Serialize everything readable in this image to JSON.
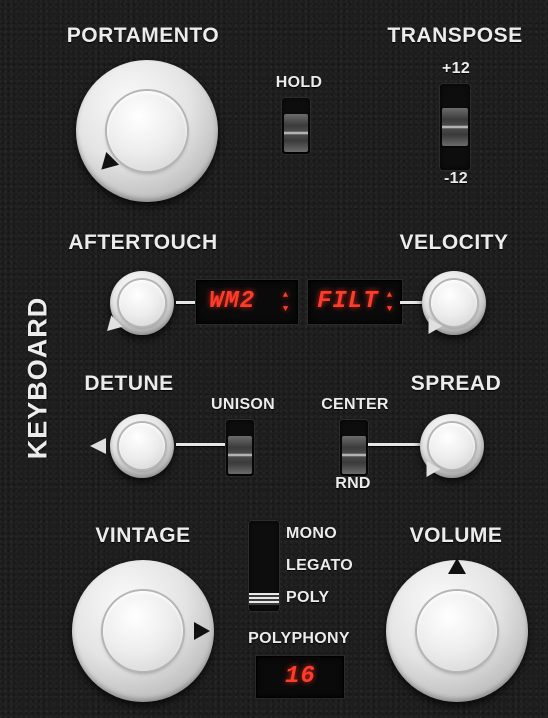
{
  "section": {
    "title": "KEYBOARD"
  },
  "portamento": {
    "label": "PORTAMENTO"
  },
  "hold": {
    "label": "HOLD"
  },
  "transpose": {
    "label": "TRANSPOSE",
    "top_value": "+12",
    "bottom_value": "-12"
  },
  "aftertouch": {
    "label": "AFTERTOUCH",
    "display": "WM2"
  },
  "velocity": {
    "label": "VELOCITY",
    "display": "FILT"
  },
  "detune": {
    "label": "DETUNE"
  },
  "unison": {
    "label": "UNISON"
  },
  "spread": {
    "label": "SPREAD"
  },
  "center_rnd": {
    "top_label": "CENTER",
    "bottom_label": "RND"
  },
  "vintage": {
    "label": "VINTAGE"
  },
  "voice_mode": {
    "options": [
      "MONO",
      "LEGATO",
      "POLY"
    ],
    "selected": "POLY"
  },
  "volume": {
    "label": "VOLUME"
  },
  "polyphony": {
    "label": "POLYPHONY",
    "display": "16"
  },
  "colors": {
    "panel": "#1d1d1d",
    "text": "#ececec",
    "lcd_red": "#ff3b2b",
    "knob": "#e8e8e8"
  }
}
